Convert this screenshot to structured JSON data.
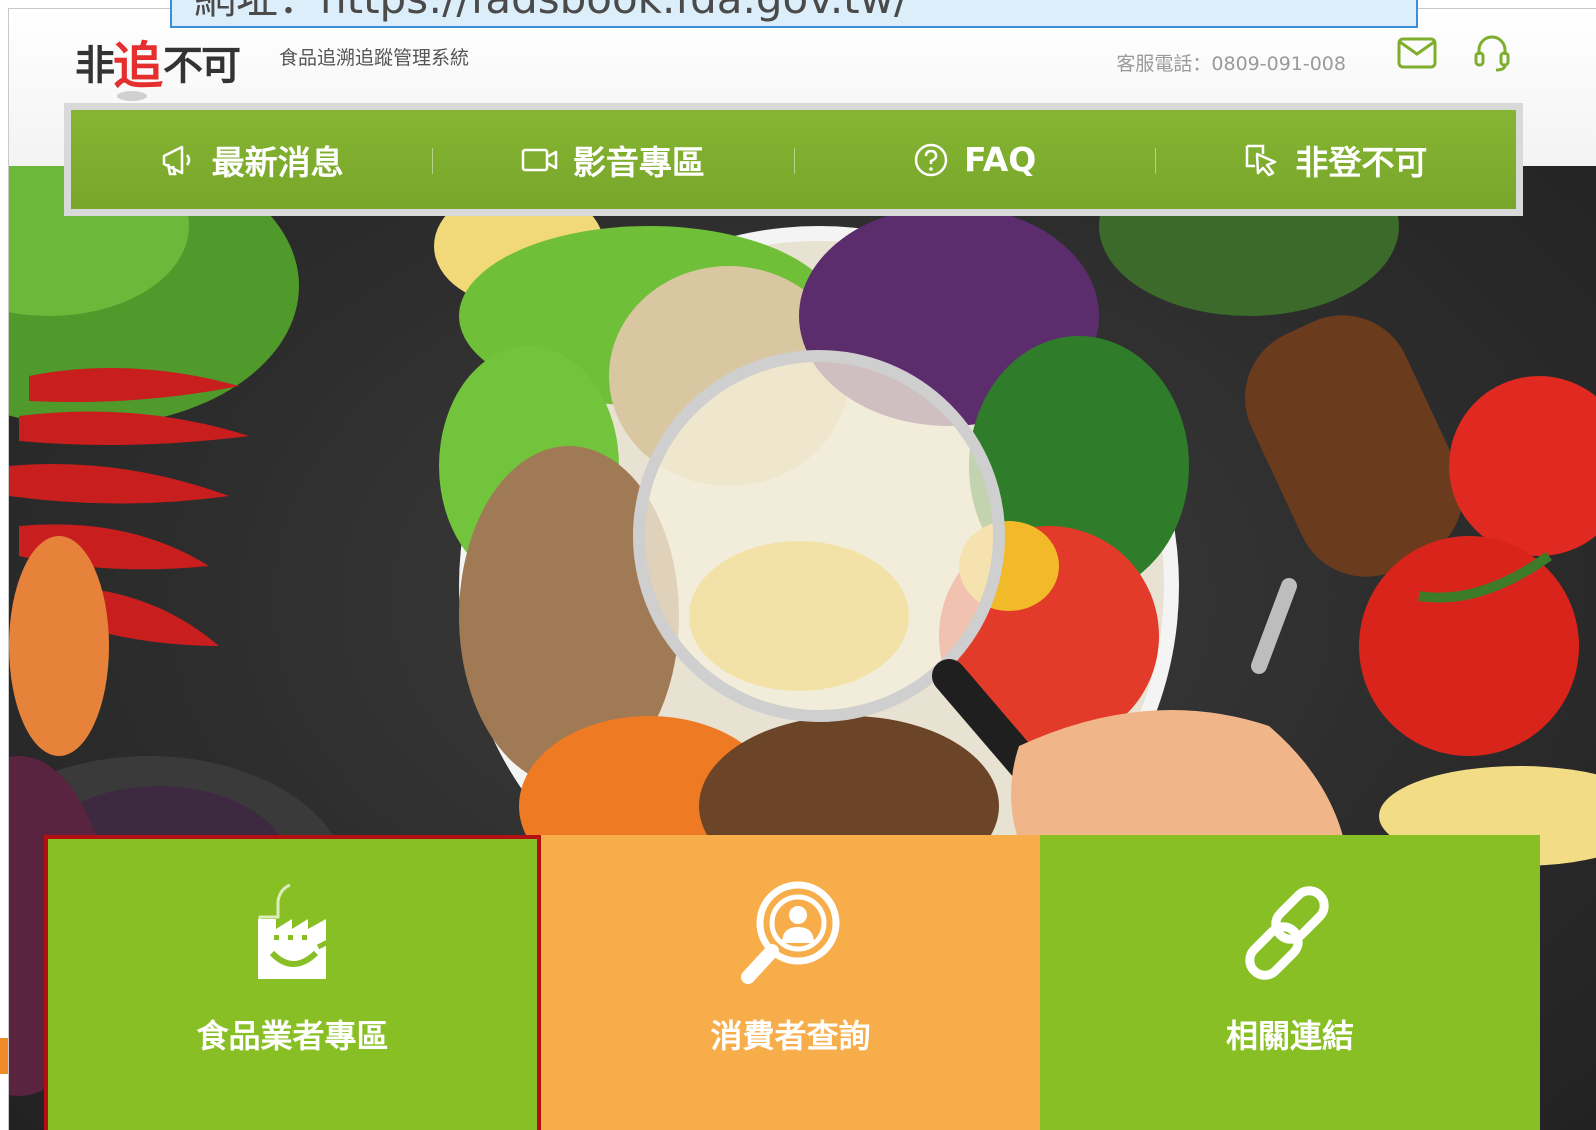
{
  "banner": {
    "text": "網址：https://fadsbook.fda.gov.tw/"
  },
  "header": {
    "logo_left": "非",
    "logo_mid": "追",
    "logo_right": "不可",
    "tagline": "食品追溯追蹤管理系統",
    "contact": "客服電話：0809-091-008",
    "mail_icon": "mail-icon",
    "support_icon": "headset-icon"
  },
  "nav": {
    "items": [
      {
        "label": "最新消息",
        "icon": "megaphone-icon"
      },
      {
        "label": "影音專區",
        "icon": "video-camera-icon"
      },
      {
        "label": "FAQ",
        "icon": "question-circle-icon"
      },
      {
        "label": "非登不可",
        "icon": "cursor-click-icon"
      }
    ]
  },
  "hero": {
    "description_icon": "food-bowl-magnifier-image"
  },
  "tiles": [
    {
      "label": "食品業者專區",
      "icon": "factory-food-icon",
      "color": "#88bf25",
      "selected": true
    },
    {
      "label": "消費者查詢",
      "icon": "consumer-search-icon",
      "color": "#f8ad4b",
      "selected": false
    },
    {
      "label": "相關連結",
      "icon": "link-icon",
      "color": "#88bf25",
      "selected": false
    }
  ],
  "colors": {
    "nav_green": "#7eae2c",
    "tile_green": "#88bf25",
    "tile_orange": "#f8ad4b",
    "selection_red": "#b30f12",
    "logo_red": "#e52e2e"
  }
}
